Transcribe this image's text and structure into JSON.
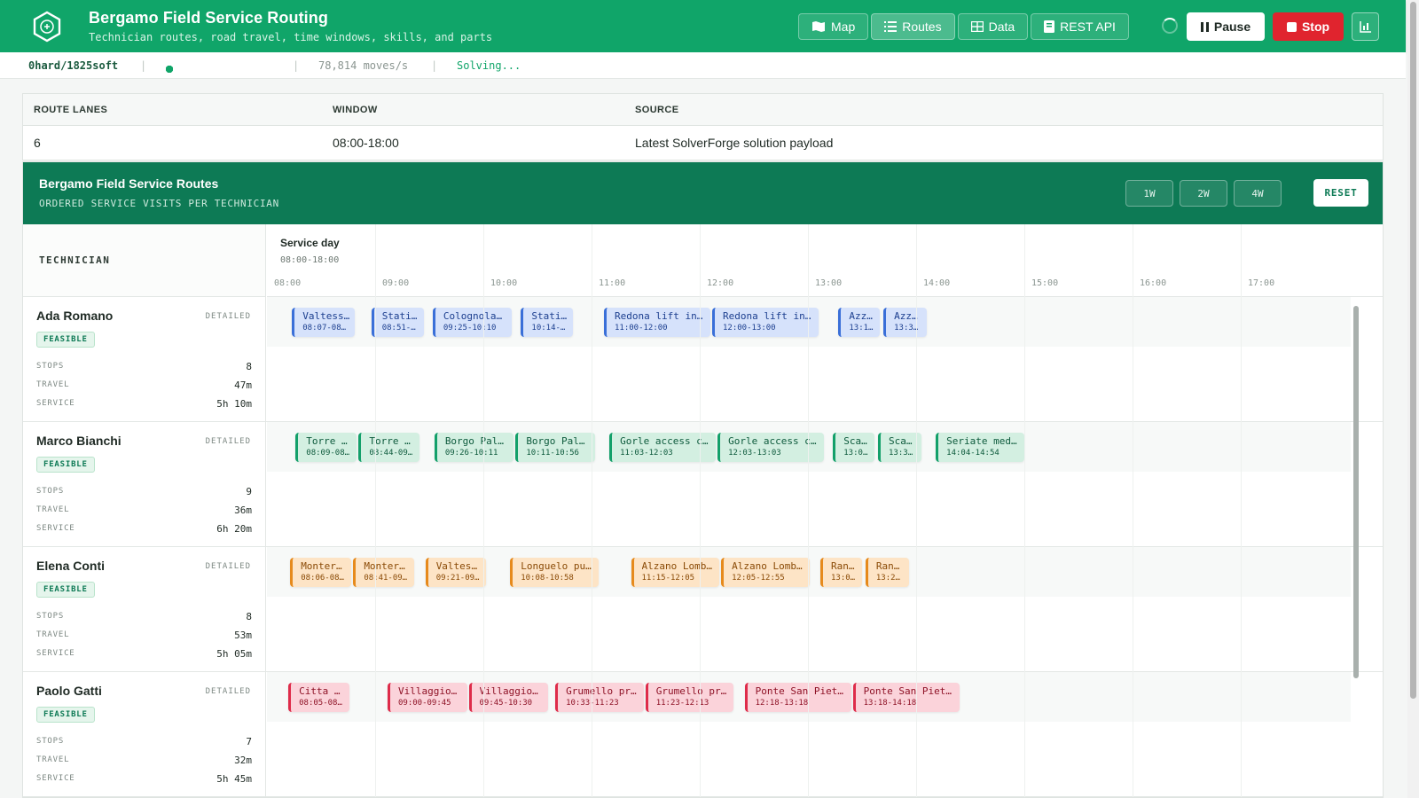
{
  "header": {
    "title": "Bergamo Field Service Routing",
    "subtitle": "Technician routes, road travel, time windows, skills, and parts",
    "nav": [
      "Map",
      "Routes",
      "Data",
      "REST API"
    ],
    "pause_label": "Pause",
    "stop_label": "Stop"
  },
  "status": {
    "score": "0hard/1825soft",
    "moves": "78,814 moves/s",
    "state": "Solving...",
    "dot_count": 10
  },
  "summary": {
    "headers": [
      "ROUTE LANES",
      "WINDOW",
      "SOURCE"
    ],
    "values": [
      "6",
      "08:00-18:00",
      "Latest SolverForge solution payload"
    ]
  },
  "routes": {
    "title": "Bergamo Field Service Routes",
    "subtitle": "ORDERED SERVICE VISITS PER TECHNICIAN",
    "zoom": [
      "1W",
      "2W",
      "4W"
    ],
    "reset_label": "RESET",
    "tech_header": "TECHNICIAN",
    "service_day": "Service day",
    "service_window": "08:00-18:00",
    "hours": [
      "08:00",
      "09:00",
      "10:00",
      "11:00",
      "12:00",
      "13:00",
      "14:00",
      "15:00",
      "16:00",
      "17:00"
    ],
    "detailed_label": "DETAILED",
    "metric_labels": [
      "STOPS",
      "TRAVEL",
      "SERVICE"
    ],
    "technicians": [
      {
        "name": "Ada Romano",
        "status": "FEASIBLE",
        "stops": "8",
        "travel": "47m",
        "service": "5h 10m",
        "color": "blue",
        "visits": [
          {
            "name": "Valtess…",
            "time": "08:07-08…",
            "start": 8.117,
            "width_h": 0.6
          },
          {
            "name": "Stati…",
            "time": "08:51-…",
            "start": 8.85,
            "width_h": 0.5
          },
          {
            "name": "Colognola …",
            "time": "09:25-10:10",
            "start": 9.417,
            "width_h": 0.75
          },
          {
            "name": "Stati…",
            "time": "10:14-…",
            "start": 10.233,
            "width_h": 0.5
          },
          {
            "name": "Redona lift ins…",
            "time": "11:00-12:00",
            "start": 11.0,
            "width_h": 1.0
          },
          {
            "name": "Redona lift ins…",
            "time": "12:00-13:00",
            "start": 12.0,
            "width_h": 1.0
          },
          {
            "name": "Azza…",
            "time": "13:1…",
            "start": 13.167,
            "width_h": 0.4
          },
          {
            "name": "Azza…",
            "time": "13:3…",
            "start": 13.583,
            "width_h": 0.42
          }
        ]
      },
      {
        "name": "Marco Bianchi",
        "status": "FEASIBLE",
        "stops": "9",
        "travel": "36m",
        "service": "6h 20m",
        "color": "green",
        "visits": [
          {
            "name": "Torre B…",
            "time": "08:09-08…",
            "start": 8.15,
            "width_h": 0.58
          },
          {
            "name": "Torre B…",
            "time": "08:44-09…",
            "start": 8.733,
            "width_h": 0.58
          },
          {
            "name": "Borgo Pala…",
            "time": "09:26-10:11",
            "start": 9.433,
            "width_h": 0.75
          },
          {
            "name": "Borgo Pala…",
            "time": "10:11-10:56",
            "start": 10.183,
            "width_h": 0.75
          },
          {
            "name": "Gorle access co…",
            "time": "11:03-12:03",
            "start": 11.05,
            "width_h": 1.0
          },
          {
            "name": "Gorle access co…",
            "time": "12:03-13:03",
            "start": 12.05,
            "width_h": 1.0
          },
          {
            "name": "Scan…",
            "time": "13:0…",
            "start": 13.117,
            "width_h": 0.4
          },
          {
            "name": "Scan…",
            "time": "13:3…",
            "start": 13.533,
            "width_h": 0.42
          },
          {
            "name": "Seriate medi…",
            "time": "14:04-14:54",
            "start": 14.067,
            "width_h": 0.833
          }
        ]
      },
      {
        "name": "Elena Conti",
        "status": "FEASIBLE",
        "stops": "8",
        "travel": "53m",
        "service": "5h 05m",
        "color": "orange",
        "visits": [
          {
            "name": "Montero…",
            "time": "08:06-08…",
            "start": 8.1,
            "width_h": 0.58
          },
          {
            "name": "Montero…",
            "time": "08:41-09…",
            "start": 8.683,
            "width_h": 0.58
          },
          {
            "name": "Valtess…",
            "time": "09:21-09…",
            "start": 9.35,
            "width_h": 0.58
          },
          {
            "name": "Longuelo pum…",
            "time": "10:08-10:58",
            "start": 10.133,
            "width_h": 0.833
          },
          {
            "name": "Alzano Lomba…",
            "time": "11:15-12:05",
            "start": 11.25,
            "width_h": 0.833
          },
          {
            "name": "Alzano Lomba…",
            "time": "12:05-12:55",
            "start": 12.083,
            "width_h": 0.833
          },
          {
            "name": "Rani…",
            "time": "13:0…",
            "start": 13.0,
            "width_h": 0.4
          },
          {
            "name": "Rani…",
            "time": "13:2…",
            "start": 13.417,
            "width_h": 0.42
          }
        ]
      },
      {
        "name": "Paolo Gatti",
        "status": "FEASIBLE",
        "stops": "7",
        "travel": "32m",
        "service": "5h 45m",
        "color": "red",
        "visits": [
          {
            "name": "Citta A…",
            "time": "08:05-08…",
            "start": 8.083,
            "width_h": 0.58
          },
          {
            "name": "Villaggio …",
            "time": "09:00-09:45",
            "start": 9.0,
            "width_h": 0.75
          },
          {
            "name": "Villaggio …",
            "time": "09:45-10:30",
            "start": 9.75,
            "width_h": 0.75
          },
          {
            "name": "Grumello pre…",
            "time": "10:33-11:23",
            "start": 10.55,
            "width_h": 0.833
          },
          {
            "name": "Grumello pre…",
            "time": "11:23-12:13",
            "start": 11.383,
            "width_h": 0.833
          },
          {
            "name": "Ponte San Pietr…",
            "time": "12:18-13:18",
            "start": 12.3,
            "width_h": 1.0
          },
          {
            "name": "Ponte San Pietr…",
            "time": "13:18-14:18",
            "start": 13.3,
            "width_h": 1.0
          }
        ]
      }
    ]
  }
}
